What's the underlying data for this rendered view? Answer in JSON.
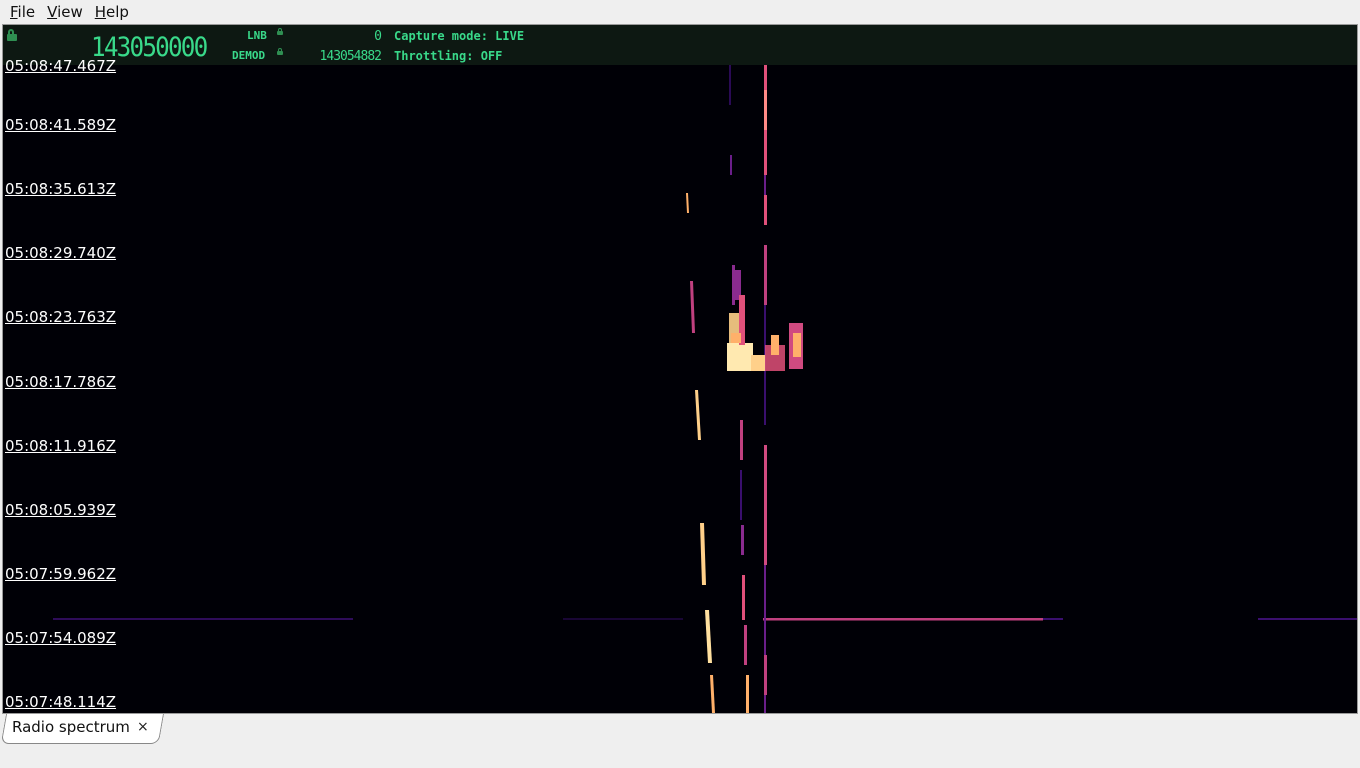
{
  "menu": [
    {
      "label": "File",
      "mnemonic": "F",
      "rest": "ile"
    },
    {
      "label": "View",
      "mnemonic": "V",
      "rest": "iew"
    },
    {
      "label": "Help",
      "mnemonic": "H",
      "rest": "elp"
    }
  ],
  "header": {
    "main_frequency": "143050000",
    "lnb_label": "LNB",
    "lnb_value": "0",
    "demod_label": "DEMOD",
    "demod_value": "143054882",
    "capture_mode": "Capture mode: LIVE",
    "throttling": "Throttling: OFF",
    "accent_color": "#39d98a"
  },
  "waterfall": {
    "timestamps": [
      "05:08:47.467Z",
      "05:08:41.589Z",
      "05:08:35.613Z",
      "05:08:29.740Z",
      "05:08:23.763Z",
      "05:08:17.786Z",
      "05:08:11.916Z",
      "05:08:05.939Z",
      "05:07:59.962Z",
      "05:07:54.089Z",
      "05:07:48.114Z"
    ],
    "palette": [
      "#000006",
      "#3a0f6e",
      "#8a2b8f",
      "#e0507a",
      "#ffb06a",
      "#ffe9b0"
    ]
  },
  "tabs": [
    {
      "label": "Radio spectrum",
      "close": "×"
    }
  ]
}
